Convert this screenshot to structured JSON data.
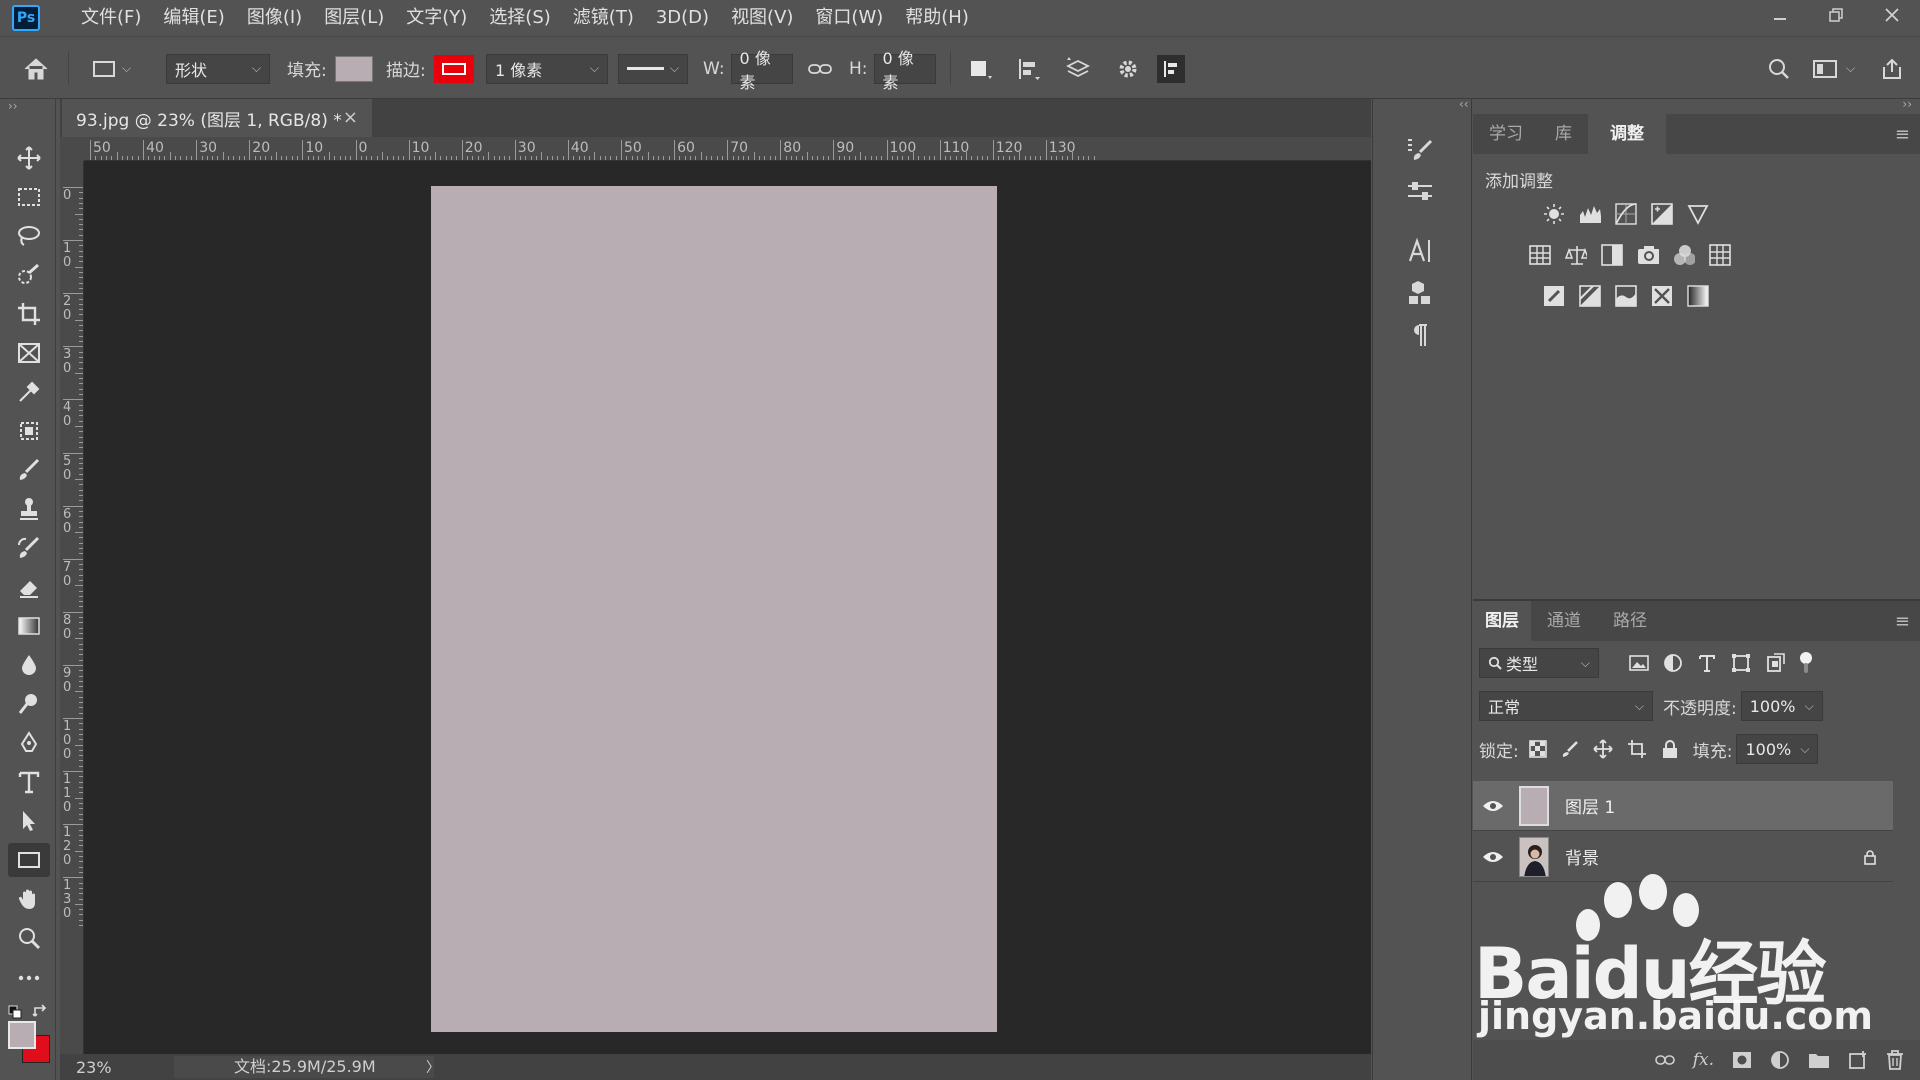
{
  "app": {
    "logo": "Ps"
  },
  "menu": [
    "文件(F)",
    "编辑(E)",
    "图像(I)",
    "图层(L)",
    "文字(Y)",
    "选择(S)",
    "滤镜(T)",
    "3D(D)",
    "视图(V)",
    "窗口(W)",
    "帮助(H)"
  ],
  "options": {
    "mode": "形状",
    "fill_label": "填充:",
    "fill_color": "#b8adb3",
    "stroke_label": "描边:",
    "stroke_color": "#e8000b",
    "stroke_width": "1 像素",
    "w_label": "W:",
    "w_value": "0 像素",
    "h_label": "H:",
    "h_value": "0 像素"
  },
  "document": {
    "tab_title": "93.jpg @ 23% (图层 1, RGB/8) *",
    "close": "×",
    "canvas_color": "#b8adb3",
    "hruler": [
      "50",
      "40",
      "30",
      "20",
      "10",
      "0",
      "10",
      "20",
      "30",
      "40",
      "50",
      "60",
      "70",
      "80",
      "90",
      "100",
      "110",
      "120",
      "130"
    ],
    "vruler": [
      "0",
      "1 0",
      "2 0",
      "3 0",
      "4 0",
      "5 0",
      "6 0",
      "7 0",
      "8 0",
      "9 0",
      "1 0 0",
      "1 1 0",
      "1 2 0",
      "1 3 0"
    ]
  },
  "status": {
    "zoom": "23%",
    "doc": "文档:25.9M/25.9M",
    "arrow": "〉"
  },
  "adjust_panel": {
    "tabs": [
      "学习",
      "库",
      "调整"
    ],
    "active_tab": "调整",
    "title": "添加调整"
  },
  "layers_panel": {
    "tabs": [
      "图层",
      "通道",
      "路径"
    ],
    "active_tab": "图层",
    "filter": "类型",
    "blend_mode": "正常",
    "opacity_label": "不透明度:",
    "opacity": "100%",
    "lock_label": "锁定:",
    "fill_label": "填充:",
    "fill": "100%",
    "layers": [
      {
        "name": "图层 1",
        "selected": true
      },
      {
        "name": "背景",
        "selected": false
      }
    ]
  },
  "watermark": {
    "brand": "Baidu经验",
    "url": "jingyan.baidu.com"
  }
}
